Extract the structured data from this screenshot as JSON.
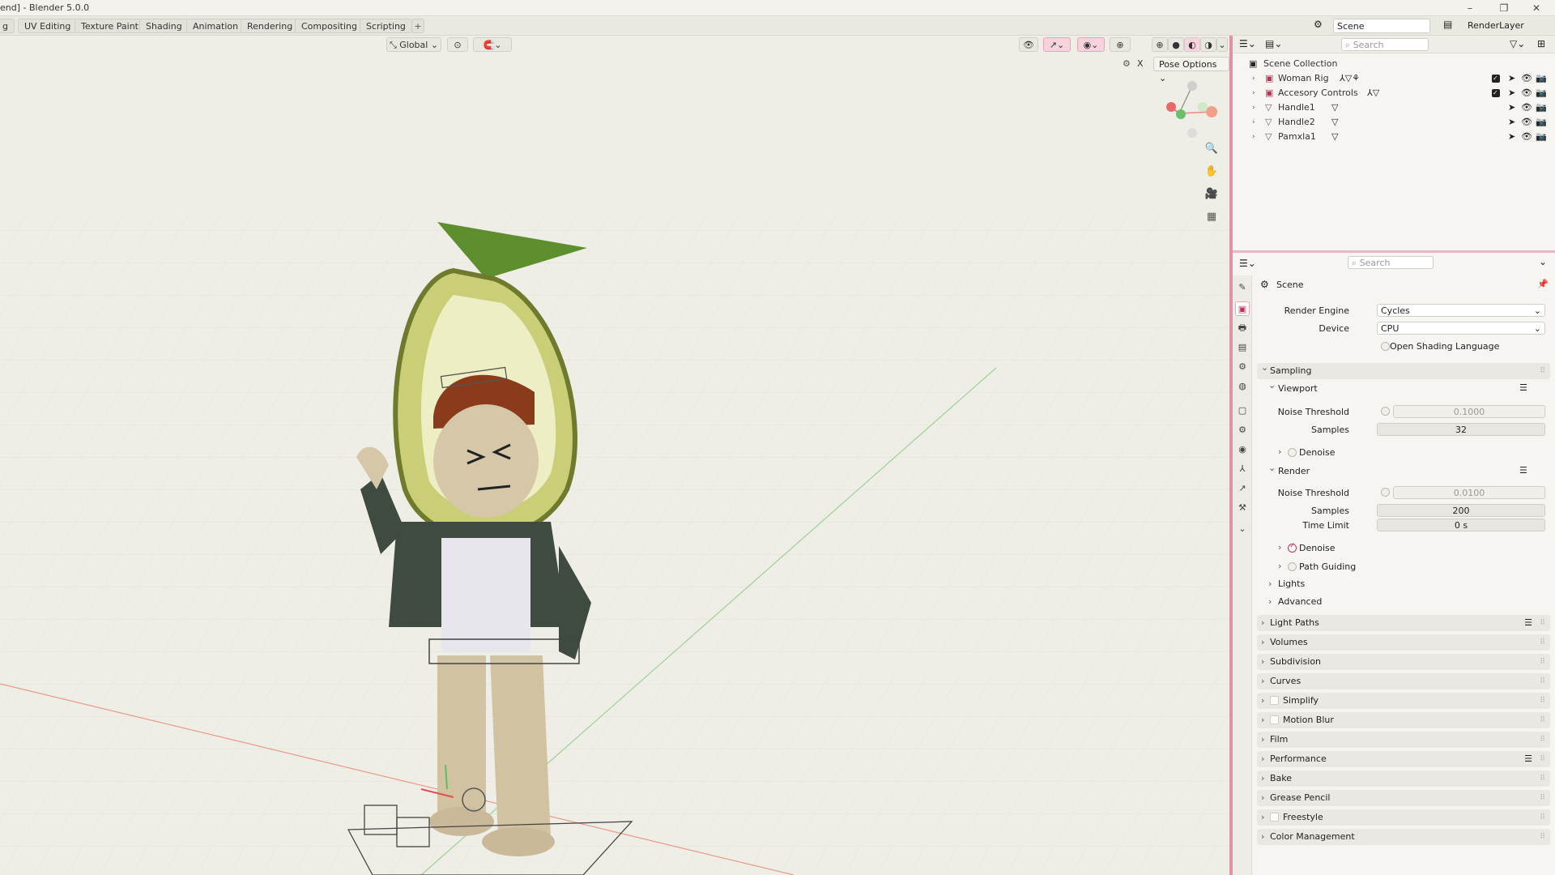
{
  "title": "end] - Blender 5.0.0",
  "workspace_tabs": [
    "g",
    "UV Editing",
    "Texture Paint",
    "Shading",
    "Animation",
    "Rendering",
    "Compositing",
    "Scripting"
  ],
  "add_tab": "+",
  "scene_selector": "Scene",
  "view_layer": "RenderLayer",
  "viewport": {
    "transform_orientation": "Global",
    "pose_options": "Pose Options",
    "x_label": "X",
    "gizmo_x": "X",
    "gizmo_y": "Y",
    "gizmo_z": "Z"
  },
  "outliner": {
    "search_placeholder": "Search",
    "root": "Scene Collection",
    "items": [
      {
        "name": "Woman Rig"
      },
      {
        "name": "Accesory Controls"
      },
      {
        "name": "Handle1"
      },
      {
        "name": "Handle2"
      },
      {
        "name": "Pamxla1"
      }
    ]
  },
  "properties": {
    "search_placeholder": "Search",
    "context": "Scene",
    "render_engine_label": "Render Engine",
    "render_engine": "Cycles",
    "device_label": "Device",
    "device": "CPU",
    "osl_label": "Open Shading Language",
    "sampling": "Sampling",
    "viewport_sub": "Viewport",
    "noise_threshold_label": "Noise Threshold",
    "vp_noise_threshold": "0.1000",
    "samples_label": "Samples",
    "vp_samples": "32",
    "denoise_label": "Denoise",
    "render_sub": "Render",
    "r_noise_threshold": "0.0100",
    "r_samples": "200",
    "time_limit_label": "Time Limit",
    "time_limit": "0 s",
    "path_guiding": "Path Guiding",
    "lights": "Lights",
    "advanced": "Advanced",
    "panels": [
      "Light Paths",
      "Volumes",
      "Subdivision",
      "Curves",
      "Simplify",
      "Motion Blur",
      "Film",
      "Performance",
      "Bake",
      "Grease Pencil",
      "Freestyle",
      "Color Management"
    ]
  }
}
